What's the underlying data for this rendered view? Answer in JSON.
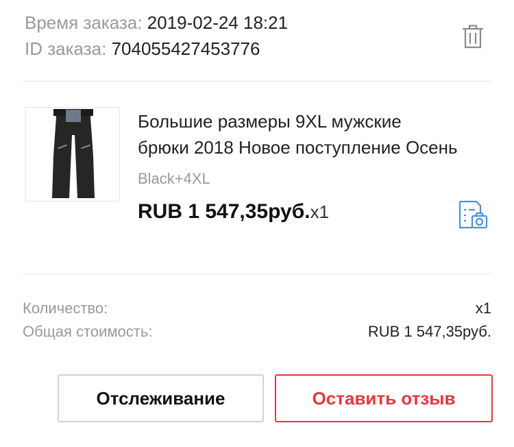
{
  "order": {
    "time_label": "Время заказа:",
    "time_value": "2019-02-24 18:21",
    "id_label": "ID заказа:",
    "id_value": "704055427453776"
  },
  "product": {
    "title_line1": "Большие размеры 9XL мужские",
    "title_line2": "брюки 2018 Новое поступление Осень",
    "variant": "Black+4XL",
    "price": "RUB 1 547,35руб.",
    "quantity": "x1",
    "image_icon": "black-pants-photo"
  },
  "summary": {
    "quantity_label": "Количество:",
    "quantity_value": "x1",
    "total_label": "Общая стоимость:",
    "total_value": "RUB 1 547,35руб."
  },
  "actions": {
    "track_label": "Отслеживание",
    "review_label": "Оставить отзыв"
  },
  "icons": {
    "delete": "trash-icon",
    "snapshot": "snapshot-camera-icon"
  },
  "colors": {
    "accent": "#e6363e",
    "snapshot_icon": "#4a90d9",
    "muted_text": "#9a9a9a"
  }
}
